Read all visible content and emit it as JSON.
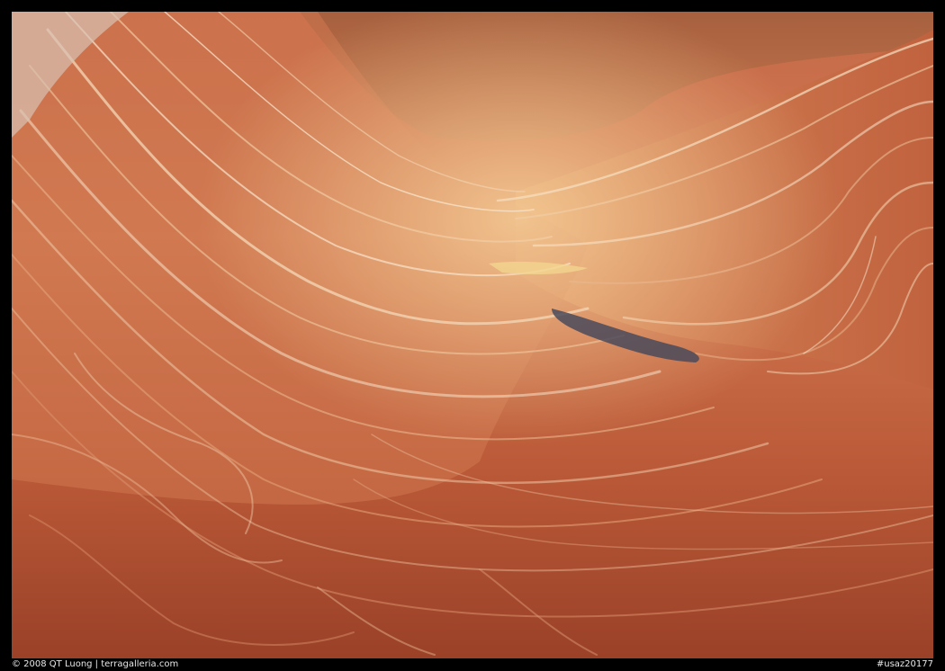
{
  "photo": {
    "subject": "layered sandstone rock waves",
    "palette": {
      "rock_deep": "#8e3b24",
      "rock_mid": "#c7643f",
      "rock_light": "#e0926a",
      "highlight": "#f2c890",
      "shadow_pool": "#4a4a5a",
      "stripe_light": "#f6dcc0"
    }
  },
  "caption": {
    "credit": "© 2008 QT Luong | terragalleria.com",
    "image_id": "#usaz20177"
  }
}
